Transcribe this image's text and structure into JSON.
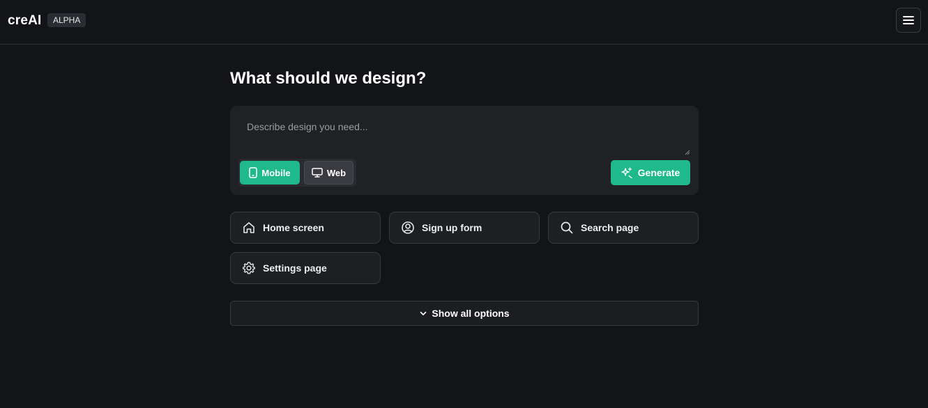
{
  "header": {
    "brand": "creAI",
    "badge": "ALPHA",
    "menu_icon": "hamburger-menu-icon"
  },
  "main": {
    "title": "What should we design?",
    "prompt": {
      "placeholder": "Describe design you need...",
      "value": ""
    },
    "platform_toggle": {
      "selected": "Mobile",
      "options": [
        {
          "label": "Mobile",
          "icon": "smartphone-icon"
        },
        {
          "label": "Web",
          "icon": "monitor-icon"
        }
      ]
    },
    "generate_label": "Generate",
    "generate_icon": "sparkles-icon",
    "suggestions": [
      {
        "label": "Home screen",
        "icon": "home-icon"
      },
      {
        "label": "Sign up form",
        "icon": "user-circle-icon"
      },
      {
        "label": "Search page",
        "icon": "search-icon"
      },
      {
        "label": "Settings page",
        "icon": "gear-icon"
      }
    ],
    "show_all_label": "Show all options",
    "show_all_icon": "chevron-down-icon"
  },
  "colors": {
    "background": "#131418",
    "accent": "#1fb98b",
    "panel": "#202125",
    "border": "#37393f"
  }
}
